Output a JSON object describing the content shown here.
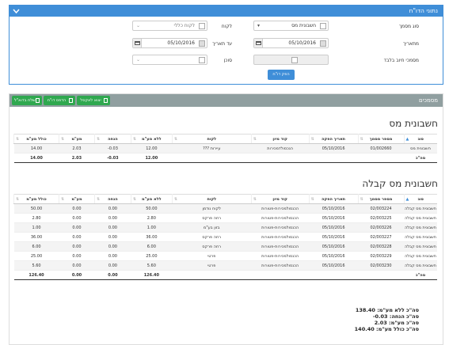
{
  "colors": {
    "primary": "#3f8ed8",
    "header_gray": "#909fa0",
    "green": "#2fa84f"
  },
  "filters": {
    "panel_title": "נתוני הדו\"ח",
    "doc_type": {
      "label": "סוג מסמך",
      "value": "חשבונית מס"
    },
    "customer": {
      "label": "לקוח",
      "placeholder": "לקוח כללי"
    },
    "from_date": {
      "label": "מתאריך",
      "value": "05/10/2016"
    },
    "to_date": {
      "label": "עד תאריך",
      "value": "05/10/2016"
    },
    "debt_only": {
      "label": "מסמכי חיוב בלבד"
    },
    "agent": {
      "label": "סוכן"
    },
    "search_button": "הפק דו\"ח"
  },
  "documents": {
    "panel_title": "מסמכים",
    "buttons": {
      "excel": "יצוא לאקסל",
      "print": "הדפס דו\"ח",
      "email": "שלח בדוא\"ל"
    }
  },
  "table1": {
    "title": "חשבונית מס",
    "columns": [
      "סוג",
      "מספר מסמך",
      "תאריך הפקה",
      "קוד מיון",
      "לקוח",
      "ללא מע\"מ",
      "הנחה",
      "מע\"מ",
      "כולל מע\"מ"
    ],
    "rows": [
      [
        "חשבונית מס",
        "01/002660",
        "05/10/2016",
        "הנכסולדמכירות",
        "עיירות ???",
        "12.00",
        "0.03-",
        "2.03",
        "14.00"
      ]
    ],
    "total": {
      "label": "סה\"כ",
      "no_vat": "12.00",
      "discount": "0.03-",
      "vat": "2.03",
      "with_vat": "14.00"
    }
  },
  "table2": {
    "title": "חשבונית מס קבלה",
    "columns": [
      "סוג",
      "מספר מסמך",
      "תאריך הפקה",
      "קוד מיון",
      "לקוח",
      "ללא מע\"מ",
      "הנחה",
      "מע\"מ",
      "כולל מע\"מ"
    ],
    "rows": [
      [
        "חשבונית מס קבלה",
        "02/003224",
        "05/10/2016",
        "הכנסולמכירות-פטורות",
        "לקוח נודמן",
        "50.00",
        "0.00",
        "0.00",
        "50.00"
      ],
      [
        "חשבונית מס קבלה",
        "02/003225",
        "05/10/2016",
        "הכנסולמכירות-פטורות",
        "רחה פרקס",
        "2.80",
        "0.00",
        "0.00",
        "2.80"
      ],
      [
        "חשבונית מס קבלה",
        "02/003226",
        "05/10/2016",
        "הכנסולמכירות-פטורות",
        "בזון בע\"מ",
        "1.00",
        "0.00",
        "0.00",
        "1.00"
      ],
      [
        "חשבונית מס קבלה",
        "02/003227",
        "05/10/2016",
        "הכנסולמכירות-פטורות",
        "רחה פרקס",
        "36.00",
        "0.00",
        "0.00",
        "36.00"
      ],
      [
        "חשבונית מס קבלה",
        "02/003228",
        "05/10/2016",
        "הכנסולמכירות-פטורות",
        "רחה פרקס",
        "6.00",
        "0.00",
        "0.00",
        "6.00"
      ],
      [
        "חשבונית מס קבלה",
        "02/003229",
        "05/10/2016",
        "הכנסולמכירות-פטורות",
        "פרטי",
        "25.00",
        "0.00",
        "0.00",
        "25.00"
      ],
      [
        "חשבונית מס קבלה",
        "02/003230",
        "05/10/2016",
        "הכנסולמכירות-פטורות",
        "פרטי",
        "5.60",
        "0.00",
        "0.00",
        "5.60"
      ]
    ],
    "total": {
      "label": "סה\"כ",
      "no_vat": "126.40",
      "discount": "0.00",
      "vat": "0.00",
      "with_vat": "126.40"
    }
  },
  "summary": {
    "no_vat": "סה\"כ ללא מע\"מ: 138.40",
    "discount": "סה\"כ הנחה: 0.03-",
    "vat": "סה\"כ מע\"מ: 2.03",
    "with_vat": "סה\"כ כולל מע\"מ: 140.40"
  }
}
